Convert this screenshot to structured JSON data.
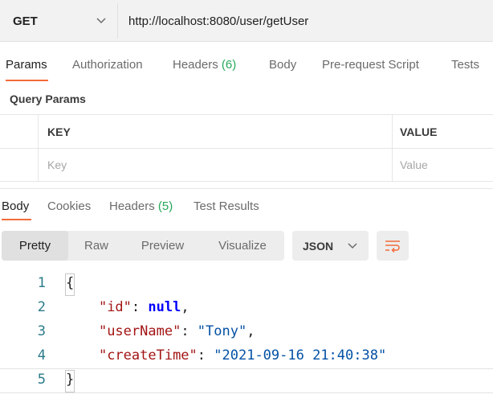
{
  "request": {
    "method": "GET",
    "url": "http://localhost:8080/user/getUser"
  },
  "request_tabs": {
    "params": "Params",
    "authorization": "Authorization",
    "headers": "Headers",
    "headers_count": "(6)",
    "body": "Body",
    "pre_request": "Pre-request Script",
    "tests": "Tests"
  },
  "query_params": {
    "title": "Query Params",
    "key_header": "KEY",
    "value_header": "VALUE",
    "key_placeholder": "Key",
    "value_placeholder": "Value"
  },
  "response_tabs": {
    "body": "Body",
    "cookies": "Cookies",
    "headers": "Headers",
    "headers_count": "(5)",
    "test_results": "Test Results"
  },
  "view_modes": {
    "pretty": "Pretty",
    "raw": "Raw",
    "preview": "Preview",
    "visualize": "Visualize"
  },
  "format": "JSON",
  "code": {
    "line_numbers": [
      "1",
      "2",
      "3",
      "4",
      "5"
    ],
    "open_brace": "{",
    "close_brace": "}",
    "k1": "\"id\"",
    "v1": "null",
    "k2": "\"userName\"",
    "v2": "\"Tony\"",
    "k3": "\"createTime\"",
    "v3": "\"2021-09-16 21:40:38\""
  },
  "colors": {
    "accent": "#f26b3a",
    "count_green": "#26a85a"
  }
}
